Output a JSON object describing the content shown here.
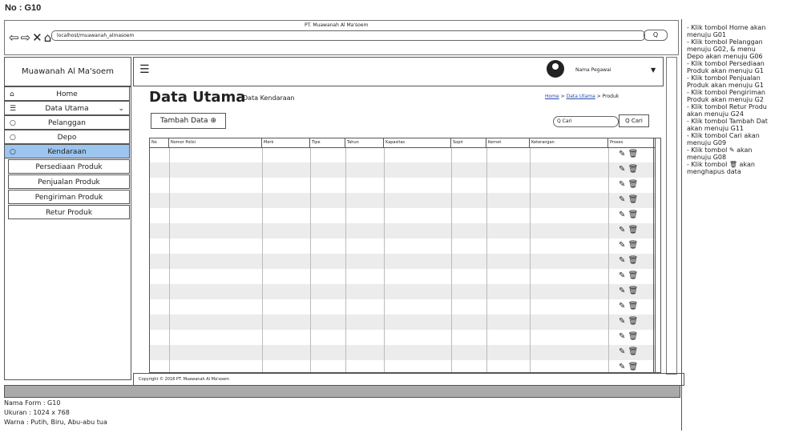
{
  "header": {
    "no": "No : G10"
  },
  "browser": {
    "title": "PT. Muawanah Al Ma'soem",
    "url": "localhost/muawanah_almasoem",
    "search_label": "Q"
  },
  "brand": "Muawanah Al Ma'soem",
  "user": {
    "name": "Nama Pegawai"
  },
  "sidebar": {
    "items": [
      {
        "label": "Home",
        "icon": "home-icon"
      },
      {
        "label": "Data Utama",
        "icon": "database-icon"
      },
      {
        "label": "Pelanggan",
        "icon": "circle-icon"
      },
      {
        "label": "Depo",
        "icon": "circle-icon"
      },
      {
        "label": "Kendaraan",
        "icon": "circle-icon",
        "active": true
      }
    ],
    "subs": [
      "Persediaan Produk",
      "Penjualan Produk",
      "Pengiriman Produk",
      "Retur Produk"
    ]
  },
  "page": {
    "title": "Data Utama",
    "subtitle": "Data Kendaraan"
  },
  "breadcrumb": {
    "home": "Home",
    "mid": "Data Utama",
    "current": "Produk",
    "sep": ">"
  },
  "actions": {
    "tambah": "Tambah Data",
    "search_placeholder": "Q Cari",
    "search_button": "Q Cari"
  },
  "table": {
    "columns": [
      "No",
      "Nomor Polisi",
      "Merk",
      "Tipe",
      "Tahun",
      "Kapasitas",
      "Sopir",
      "Kernet",
      "Keterangan",
      "Proses"
    ],
    "rows": 15
  },
  "footer": "Copyright © 2018 PT. Muawanah Al Ma'soem",
  "meta": [
    "Nama Form : G10",
    "Ukuran : 1024 x 768",
    "Warna : Putih, Biru, Abu-abu tua"
  ],
  "notes": [
    "Klik tombol Home akan",
    "menuju G01",
    "Klik tombol Pelanggan",
    "menuju G02, & menu",
    "Depo akan menuju G06",
    "Klik tombol Persediaan",
    "Produk akan menuju G1",
    "Klik tombol Penjualan",
    "Produk akan menuju G1",
    "Klik tombol Pengiriman",
    "Produk akan menuju G2",
    "Klik tombol Retur Produ",
    "akan menuju G24",
    "Klik tombol Tambah Dat",
    "akan menuju G11",
    "Klik tombol Cari akan",
    "menuju G09",
    "Klik tombol ✎ akan",
    "menuju G08",
    "Klik tombol 🗑 akan",
    "menghapus data"
  ]
}
